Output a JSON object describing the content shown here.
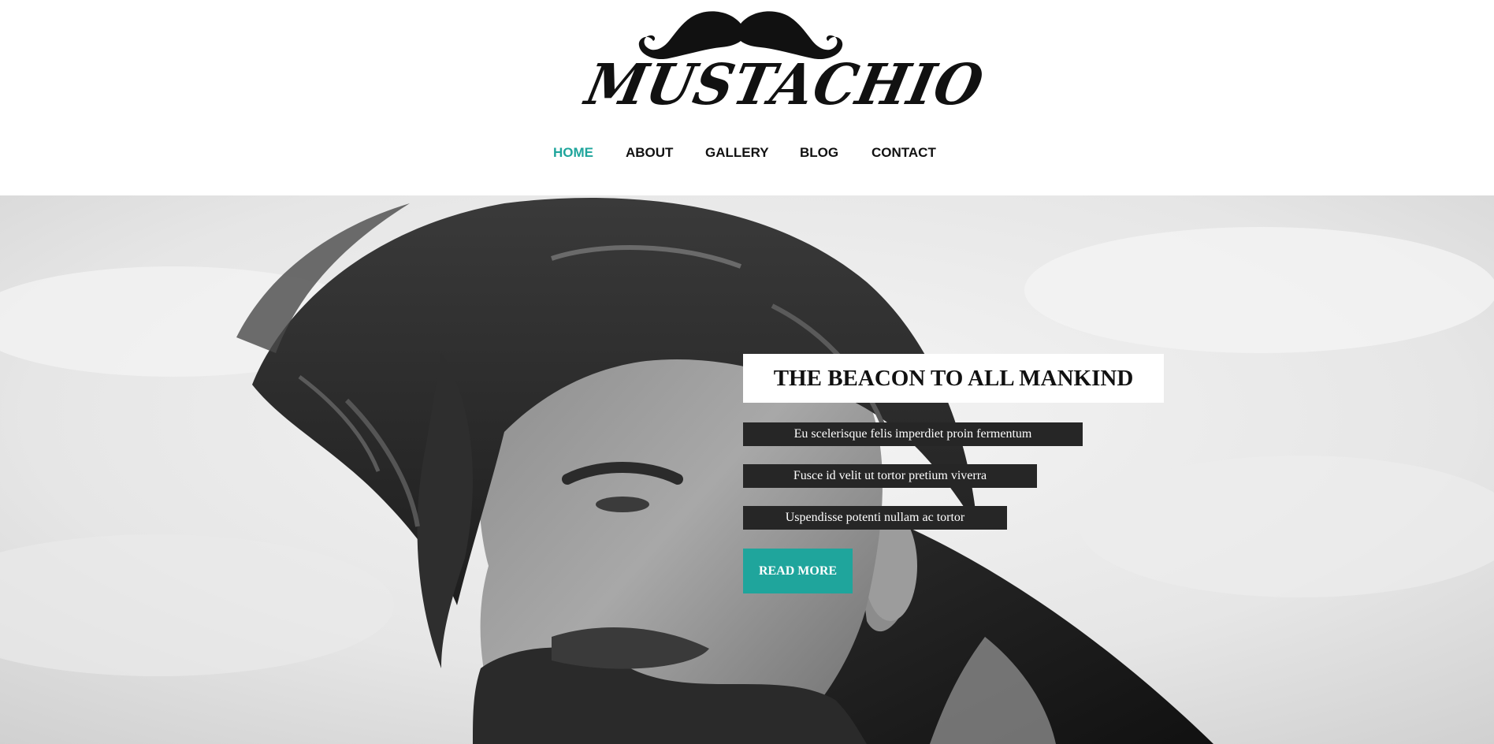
{
  "brand": {
    "name": "MUSTACHIO",
    "logo_icon": "mustache-icon"
  },
  "nav": {
    "items": [
      {
        "label": "HOME",
        "active": true
      },
      {
        "label": "ABOUT",
        "active": false
      },
      {
        "label": "GALLERY",
        "active": false
      },
      {
        "label": "BLOG",
        "active": false
      },
      {
        "label": "CONTACT",
        "active": false
      }
    ]
  },
  "hero": {
    "headline": "THE BEACON TO ALL MANKIND",
    "lines": [
      "Eu scelerisque felis imperdiet proin fermentum",
      "Fusce id velit ut tortor pretium viverra",
      "Uspendisse potenti nullam ac tortor"
    ],
    "cta_label": "READ MORE",
    "background_image": "bearded-man-photo"
  },
  "colors": {
    "accent": "#1fa59c",
    "text": "#111111",
    "dark_box": "#262626",
    "background": "#ffffff"
  }
}
